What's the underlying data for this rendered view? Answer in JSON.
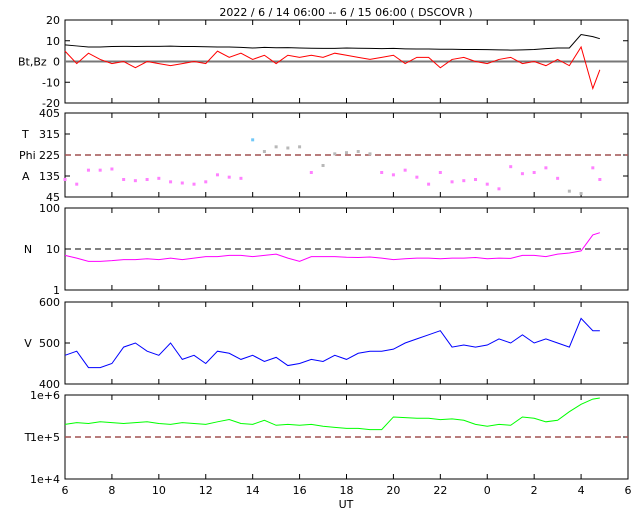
{
  "chart_data": [
    {
      "type": "line",
      "title": "2022 /  6 / 14   06:00 --  6 / 15   06:00 ( DSCOVR )",
      "ylabel": "Bt,Bz",
      "ylim": [
        -20,
        20
      ],
      "yticks": [
        "20",
        "10",
        "0",
        "-10",
        "-20"
      ],
      "scale": "linear",
      "series": [
        {
          "name": "Bt",
          "color": "#000000",
          "values": [
            8,
            7.5,
            7,
            7,
            7.2,
            7.3,
            7.2,
            7.3,
            7.3,
            7.4,
            7.2,
            7.2,
            7.1,
            7,
            7,
            6.8,
            6.5,
            6.8,
            6.6,
            6.7,
            6.5,
            6.4,
            6.3,
            6.3,
            6.5,
            6.4,
            6.3,
            6.2,
            6.3,
            6.1,
            6,
            6,
            5.9,
            5.9,
            5.8,
            5.8,
            5.7,
            5.6,
            5.5,
            5.6,
            5.8,
            6.2,
            6.5,
            6.5,
            13,
            12,
            11
          ]
        },
        {
          "name": "Bz",
          "color": "#ff0000",
          "values": [
            5,
            -1,
            4,
            1,
            -1,
            0,
            -3,
            0,
            -1,
            -2,
            -1,
            0,
            -1,
            5,
            2,
            4,
            1,
            3,
            -1,
            3,
            2,
            3,
            2,
            4,
            3,
            2,
            1,
            2,
            3,
            -1,
            2,
            2,
            -3,
            1,
            2,
            0,
            -1,
            1,
            2,
            -1,
            0,
            -2,
            1,
            -2,
            7,
            -13,
            -4
          ]
        }
      ],
      "reference_line": 0
    },
    {
      "type": "scatter",
      "ylabel_parts": [
        "T",
        "Phi",
        "A"
      ],
      "ylim": [
        45,
        405
      ],
      "yticks": [
        "405",
        "315",
        "225",
        "135",
        "45"
      ],
      "reference_line": 225,
      "colors": {
        "A": "#ff80ff",
        "T": "#70c8f8",
        "mixed": "#b8b8b8"
      },
      "values": [
        120,
        100,
        160,
        160,
        165,
        120,
        115,
        120,
        125,
        110,
        105,
        100,
        110,
        140,
        130,
        125,
        290,
        240,
        260,
        255,
        260,
        150,
        180,
        230,
        235,
        240,
        230,
        150,
        140,
        160,
        130,
        100,
        150,
        110,
        115,
        120,
        100,
        80,
        175,
        145,
        150,
        170,
        125,
        70,
        60,
        170,
        120
      ]
    },
    {
      "type": "line",
      "ylabel": "N",
      "scale": "log",
      "ylim": [
        1,
        100
      ],
      "yticks": [
        "100",
        "10",
        "1"
      ],
      "reference_line": 10,
      "color": "#ff00ff",
      "values": [
        7,
        6,
        5,
        5,
        5.2,
        5.5,
        5.5,
        5.8,
        5.5,
        6,
        5.5,
        6,
        6.5,
        6.5,
        7,
        7,
        6.5,
        7,
        7.5,
        6,
        5,
        6.5,
        6.5,
        6.5,
        6.3,
        6.2,
        6.4,
        6,
        5.5,
        5.8,
        6,
        6,
        5.8,
        6,
        6,
        6.2,
        5.8,
        6,
        5.9,
        7,
        7,
        6.5,
        7.5,
        8,
        9,
        22,
        25
      ]
    },
    {
      "type": "line",
      "ylabel": "V",
      "ylim": [
        400,
        600
      ],
      "yticks": [
        "600",
        "500",
        "400"
      ],
      "color": "#0000ff",
      "values": [
        470,
        480,
        440,
        440,
        450,
        490,
        500,
        480,
        470,
        500,
        460,
        470,
        450,
        480,
        475,
        460,
        470,
        455,
        465,
        445,
        450,
        460,
        455,
        470,
        460,
        475,
        480,
        480,
        485,
        500,
        510,
        520,
        530,
        490,
        495,
        490,
        495,
        510,
        500,
        520,
        500,
        510,
        500,
        490,
        560,
        530,
        530
      ]
    },
    {
      "type": "line",
      "ylabel": "T",
      "scale": "log",
      "ylim": [
        10000,
        1000000
      ],
      "yticks": [
        "1e+6",
        "1e+5",
        "1e+4"
      ],
      "reference_line": 100000,
      "color": "#00ff00",
      "values": [
        200000,
        220000,
        210000,
        230000,
        220000,
        210000,
        220000,
        230000,
        210000,
        200000,
        220000,
        210000,
        200000,
        230000,
        260000,
        210000,
        200000,
        250000,
        190000,
        200000,
        190000,
        200000,
        180000,
        170000,
        160000,
        160000,
        150000,
        150000,
        300000,
        290000,
        280000,
        280000,
        260000,
        270000,
        250000,
        200000,
        180000,
        200000,
        190000,
        300000,
        280000,
        230000,
        250000,
        400000,
        600000,
        800000,
        850000
      ]
    }
  ],
  "x_axis": {
    "label": "UT",
    "ticks": [
      "6",
      "8",
      "10",
      "12",
      "14",
      "16",
      "18",
      "20",
      "22",
      "0",
      "2",
      "4",
      "6"
    ],
    "range_hours": [
      0,
      24
    ],
    "sample_hours": 0.5,
    "last_sample_hour": 22.8
  }
}
